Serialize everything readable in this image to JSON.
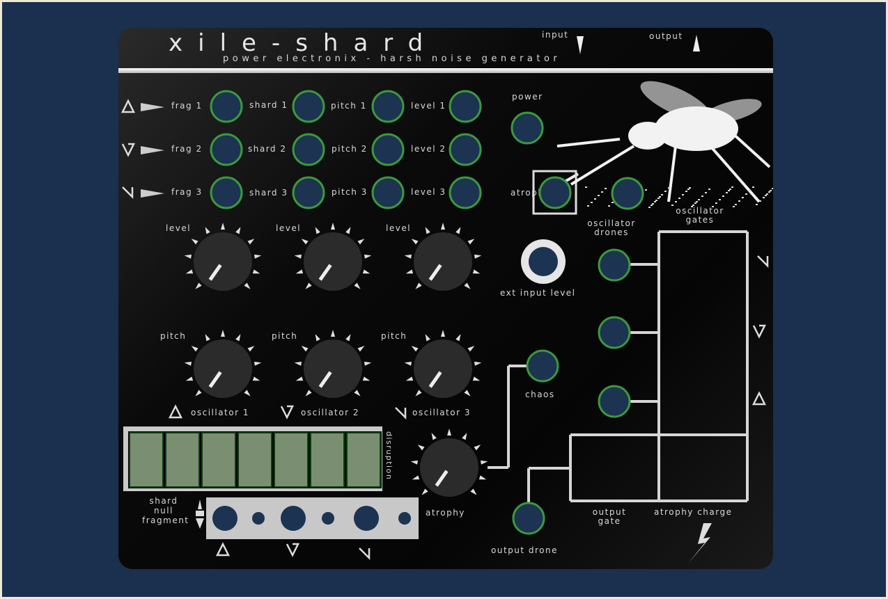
{
  "header": {
    "title": "xile-shard",
    "subtitle": "power electronix - harsh noise generator",
    "input_label": "input",
    "output_label": "output"
  },
  "matrix": {
    "rows": [
      {
        "symbol": "triangle-up",
        "labels": [
          "frag 1",
          "shard 1",
          "pitch 1",
          "level 1"
        ]
      },
      {
        "symbol": "v-shape",
        "labels": [
          "frag 2",
          "shard 2",
          "pitch 2",
          "level 2"
        ]
      },
      {
        "symbol": "slash-shape",
        "labels": [
          "frag 3",
          "shard 3",
          "pitch 3",
          "level 3"
        ]
      }
    ]
  },
  "power_label": "power",
  "atrophy_jack_label": "atrophy",
  "oscillator_gates_label": "oscillator gates",
  "oscillator_drones_label": "oscillator drones",
  "ext_input_level_label": "ext input level",
  "chaos_label": "chaos",
  "knobs": {
    "level_label": "level",
    "pitch_label": "pitch",
    "atrophy_label": "atrophy",
    "values": {
      "level": [
        0,
        0,
        0
      ],
      "pitch": [
        0,
        0,
        0
      ],
      "atrophy": 0
    }
  },
  "oscillators": [
    "oscillator 1",
    "oscillator 2",
    "oscillator 3"
  ],
  "disruption": {
    "label": "disruption",
    "cells": 7
  },
  "null_selector": {
    "labels": [
      "shard",
      "null",
      "fragment"
    ]
  },
  "output_gate_label": "output gate",
  "atrophy_charge_label": "atrophy charge",
  "output_drone_label": "output drone",
  "colors": {
    "background": "#1b2f4e",
    "jack_fill": "#1c3352",
    "jack_ring": "#3a9a3a",
    "panel": "#0a0a0a",
    "text": "#d8d8d8",
    "display": "#7a8e72"
  }
}
